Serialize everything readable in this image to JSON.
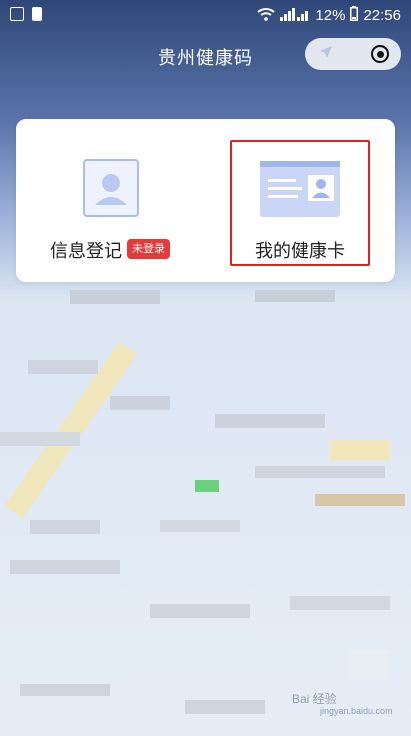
{
  "status_bar": {
    "battery_percent": "12%",
    "time": "22:56"
  },
  "header": {
    "title": "贵州健康码"
  },
  "card": {
    "register": {
      "label": "信息登记",
      "badge": "未登录"
    },
    "health_card": {
      "label": "我的健康卡"
    }
  },
  "watermark": {
    "text": "Bai 经验",
    "sub": "jingyan.baidu.com"
  },
  "colors": {
    "accent_red": "#e02020",
    "badge_red": "#e53a3a",
    "icon_blue": "#a9bef0"
  }
}
